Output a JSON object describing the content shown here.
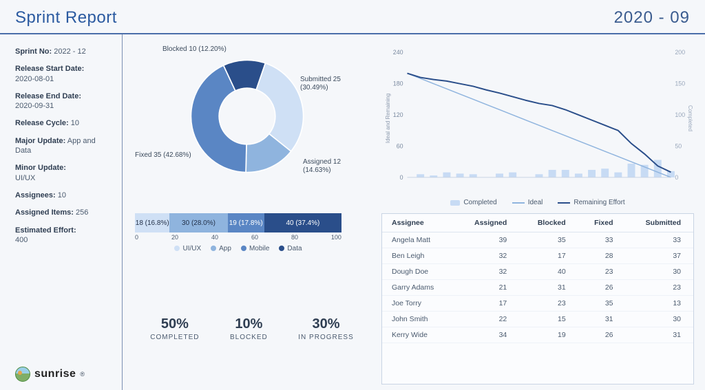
{
  "header": {
    "title": "Sprint Report",
    "period": "2020 - 09"
  },
  "sidebar": {
    "meta": [
      {
        "label": "Sprint No:",
        "value": "2022 - 12"
      },
      {
        "label": "Release Start Date:",
        "value": "2020-08-01"
      },
      {
        "label": "Release End Date:",
        "value": "2020-09-31"
      },
      {
        "label": "Release Cycle:",
        "value": "10"
      },
      {
        "label": "Major Update:",
        "value": "App and Data"
      },
      {
        "label": "Minor Update:",
        "value": "UI/UX"
      },
      {
        "label": "Assignees:",
        "value": "10"
      },
      {
        "label": "Assigned Items:",
        "value": "256"
      },
      {
        "label": "Estimated Effort:",
        "value": "400"
      }
    ],
    "brand": "sunrise"
  },
  "donut": {
    "labels": {
      "blocked": "Blocked\n10 (12.20%)",
      "submitted": "Submitted\n25 (30.49%)",
      "assigned": "Assigned\n12 (14.63%)",
      "fixed": "Fixed\n35 (42.68%)"
    }
  },
  "burndown": {
    "legend": {
      "completed": "Completed",
      "ideal": "Ideal",
      "remaining": "Remaining Effort"
    },
    "y_left_label": "Ideal and Remaining",
    "y_right_label": "Completed"
  },
  "stacked": {
    "segs": [
      {
        "text": "18 (16.8%)",
        "color": "#cfe0f5"
      },
      {
        "text": "30 (28.0%)",
        "color": "#8fb4de"
      },
      {
        "text": "19 (17.8%)",
        "color": "#5a86c4"
      },
      {
        "text": "40 (37.4%)",
        "color": "#2a4e8a"
      }
    ],
    "ticks": [
      "0",
      "20",
      "40",
      "60",
      "80",
      "100"
    ],
    "legend": [
      {
        "name": "UI/UX",
        "color": "#cfe0f5"
      },
      {
        "name": "App",
        "color": "#8fb4de"
      },
      {
        "name": "Mobile",
        "color": "#5a86c4"
      },
      {
        "name": "Data",
        "color": "#2a4e8a"
      }
    ]
  },
  "stats": [
    {
      "pct": "50%",
      "label": "COMPLETED"
    },
    {
      "pct": "10%",
      "label": "BLOCKED"
    },
    {
      "pct": "30%",
      "label": "IN PROGRESS"
    }
  ],
  "table": {
    "headers": [
      "Assignee",
      "Assigned",
      "Blocked",
      "Fixed",
      "Submitted"
    ],
    "rows": [
      [
        "Angela Matt",
        "39",
        "35",
        "33",
        "33"
      ],
      [
        "Ben Leigh",
        "32",
        "17",
        "28",
        "37"
      ],
      [
        "Dough Doe",
        "32",
        "40",
        "23",
        "30"
      ],
      [
        "Garry Adams",
        "21",
        "31",
        "26",
        "23"
      ],
      [
        "Joe Torry",
        "17",
        "23",
        "35",
        "13"
      ],
      [
        "John Smith",
        "22",
        "15",
        "31",
        "30"
      ],
      [
        "Kerry Wide",
        "34",
        "19",
        "26",
        "31"
      ]
    ]
  },
  "colors": {
    "dk": "#2a4e8a",
    "md": "#5a86c4",
    "lt": "#8fb4de",
    "vlt": "#cfe0f5",
    "bar_fill": "#c7dbf4"
  },
  "chart_data": [
    {
      "type": "pie",
      "title": "Sprint items by status",
      "series": [
        {
          "name": "Submitted",
          "value": 25,
          "pct": 30.49,
          "color": "#cfe0f5"
        },
        {
          "name": "Assigned",
          "value": 12,
          "pct": 14.63,
          "color": "#8fb4de"
        },
        {
          "name": "Fixed",
          "value": 35,
          "pct": 42.68,
          "color": "#5a86c4"
        },
        {
          "name": "Blocked",
          "value": 10,
          "pct": 12.2,
          "color": "#2a4e8a"
        }
      ]
    },
    {
      "type": "line",
      "title": "Burndown",
      "xlabel": "",
      "ylabel": "Ideal and Remaining",
      "y2label": "Completed",
      "ylim": [
        0,
        240
      ],
      "y2lim": [
        0,
        200
      ],
      "x": [
        1,
        2,
        3,
        4,
        5,
        6,
        7,
        8,
        9,
        10,
        11,
        12,
        13,
        14,
        15,
        16,
        17,
        18,
        19,
        20,
        21
      ],
      "series": [
        {
          "name": "Ideal",
          "axis": "left",
          "color": "#8fb4de",
          "values": [
            200,
            190,
            180,
            170,
            160,
            150,
            140,
            130,
            120,
            110,
            100,
            90,
            80,
            70,
            60,
            50,
            40,
            30,
            20,
            10,
            0
          ]
        },
        {
          "name": "Remaining Effort",
          "axis": "left",
          "color": "#2a4e8a",
          "values": [
            200,
            192,
            188,
            185,
            180,
            175,
            168,
            162,
            155,
            148,
            142,
            138,
            130,
            120,
            110,
            100,
            90,
            65,
            45,
            22,
            10
          ]
        },
        {
          "name": "Completed",
          "axis": "right",
          "type": "bar",
          "color": "#c7dbf4",
          "values": [
            0,
            5,
            3,
            8,
            6,
            5,
            0,
            6,
            8,
            0,
            5,
            12,
            12,
            6,
            12,
            14,
            8,
            22,
            20,
            28,
            10
          ]
        }
      ],
      "y_ticks_left": [
        0,
        60,
        120,
        180,
        240
      ],
      "y_ticks_right": [
        0,
        50,
        100,
        150,
        200
      ]
    },
    {
      "type": "bar",
      "title": "Items by category",
      "orientation": "horizontal-stacked",
      "xlim": [
        0,
        100
      ],
      "categories": [
        "UI/UX",
        "App",
        "Mobile",
        "Data"
      ],
      "values": [
        18,
        30,
        19,
        40
      ],
      "pct": [
        16.8,
        28.0,
        17.8,
        37.4
      ]
    },
    {
      "type": "table",
      "title": "Assignee breakdown",
      "columns": [
        "Assignee",
        "Assigned",
        "Blocked",
        "Fixed",
        "Submitted"
      ],
      "rows": [
        [
          "Angela Matt",
          39,
          35,
          33,
          33
        ],
        [
          "Ben Leigh",
          32,
          17,
          28,
          37
        ],
        [
          "Dough Doe",
          32,
          40,
          23,
          30
        ],
        [
          "Garry Adams",
          21,
          31,
          26,
          23
        ],
        [
          "Joe Torry",
          17,
          23,
          35,
          13
        ],
        [
          "John Smith",
          22,
          15,
          31,
          30
        ],
        [
          "Kerry Wide",
          34,
          19,
          26,
          31
        ]
      ]
    }
  ]
}
